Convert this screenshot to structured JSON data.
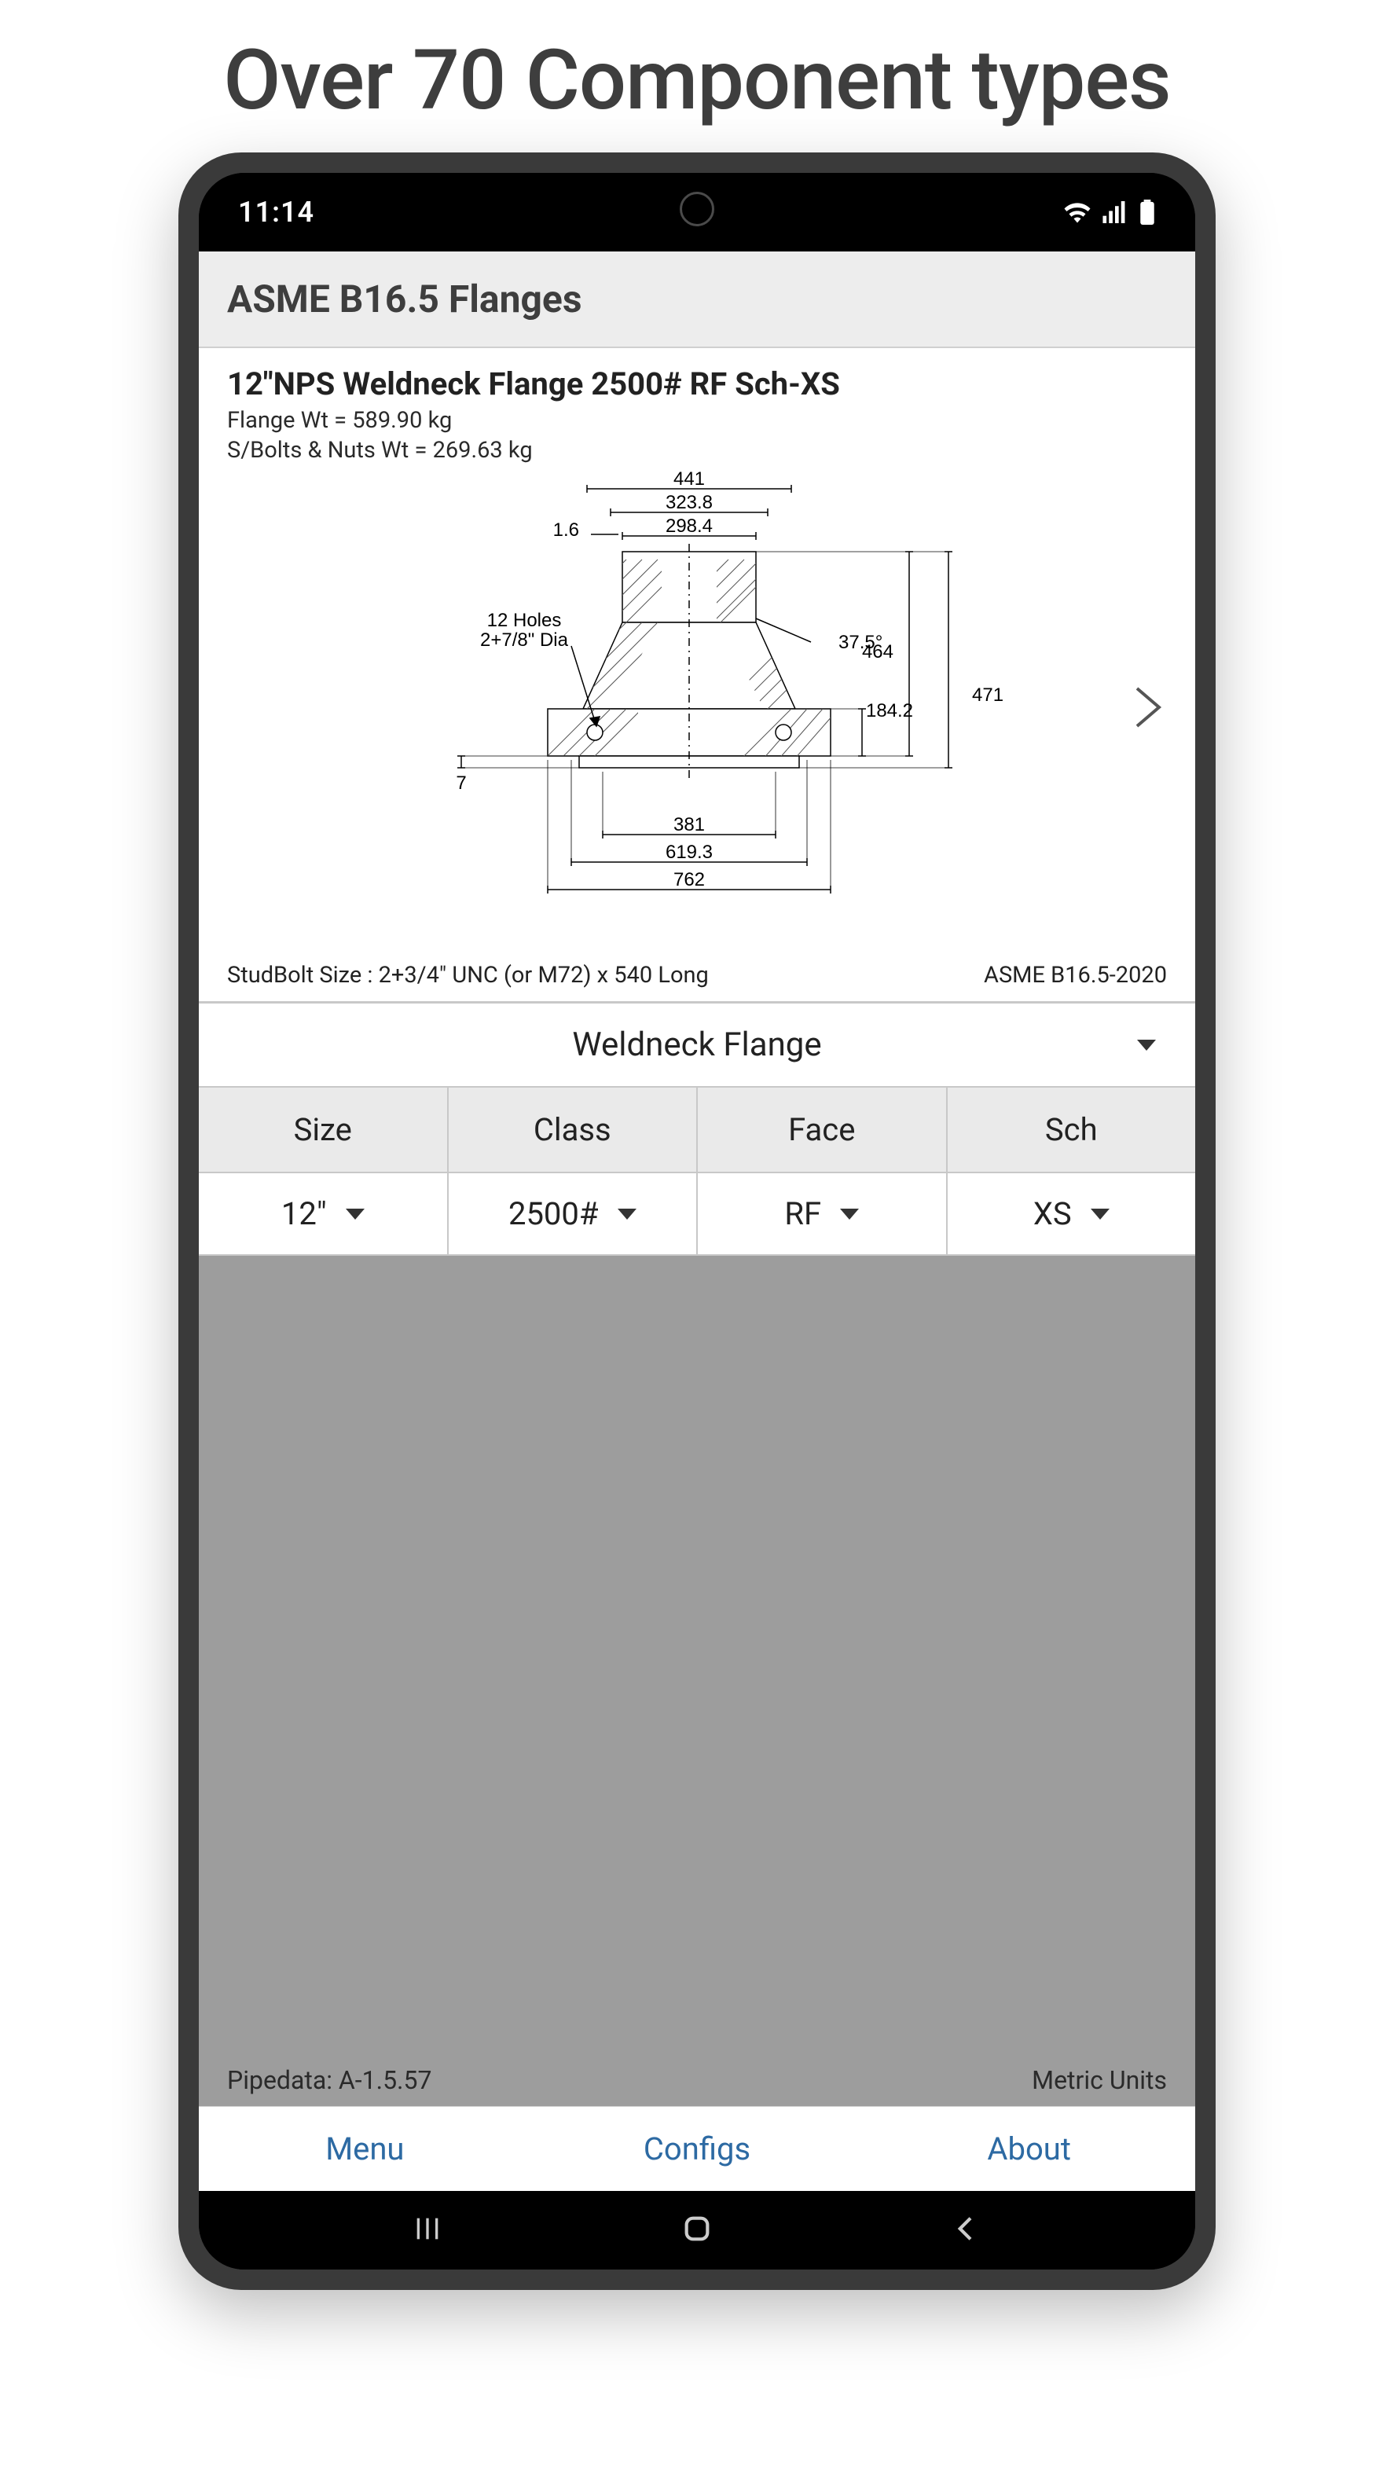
{
  "marketing_title": "Over 70 Component types",
  "status": {
    "time": "11:14"
  },
  "header": {
    "title": "ASME B16.5 Flanges"
  },
  "detail": {
    "title": "12\"NPS Weldneck Flange 2500# RF Sch-XS",
    "flange_wt": "Flange Wt =  589.90 kg",
    "bolt_wt": "S/Bolts & Nuts Wt =  269.63 kg",
    "studbolt": "StudBolt Size : 2+3/4\" UNC  (or M72)  x 540 Long",
    "standard": "ASME B16.5-2020"
  },
  "drawing": {
    "dim_441": "441",
    "dim_3238": "323.8",
    "dim_2984": "298.4",
    "dim_16": "1.6",
    "dim_holes_a": "12 Holes",
    "dim_holes_b": "2+7/8\" Dia",
    "dim_375": "37.5°",
    "dim_464": "464",
    "dim_471": "471",
    "dim_1842": "184.2",
    "dim_7": "7",
    "dim_381": "381",
    "dim_6193": "619.3",
    "dim_762": "762"
  },
  "type_select": {
    "value": "Weldneck Flange"
  },
  "params": {
    "headers": [
      "Size",
      "Class",
      "Face",
      "Sch"
    ],
    "values": [
      "12\"",
      "2500#",
      "RF",
      "XS"
    ]
  },
  "footer": {
    "version": "Pipedata: A-1.5.57",
    "units": "Metric Units"
  },
  "bottom": {
    "menu": "Menu",
    "configs": "Configs",
    "about": "About"
  }
}
